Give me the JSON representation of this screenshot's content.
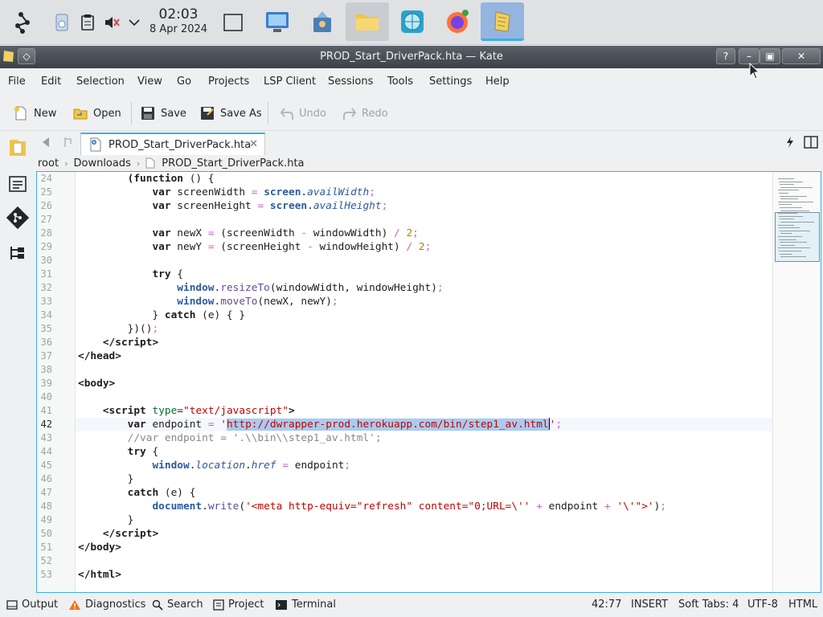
{
  "taskbar": {
    "time": "02:03",
    "date": "8 Apr 2024"
  },
  "window": {
    "title": "PROD_Start_DriverPack.hta — Kate",
    "help_button": "?"
  },
  "menu": {
    "file": "File",
    "edit": "Edit",
    "selection": "Selection",
    "view": "View",
    "go": "Go",
    "projects": "Projects",
    "lsp": "LSP Client",
    "sessions": "Sessions",
    "tools": "Tools",
    "settings": "Settings",
    "help": "Help"
  },
  "toolbar": {
    "new": "New",
    "open": "Open",
    "save": "Save",
    "save_as": "Save As",
    "undo": "Undo",
    "redo": "Redo"
  },
  "tab": {
    "label": "PROD_Start_DriverPack.hta",
    "close": "✕"
  },
  "breadcrumb": {
    "root": "root",
    "folder": "Downloads",
    "file": "PROD_Start_DriverPack.hta"
  },
  "editor": {
    "current_line": 42,
    "line_numbers": [
      "24",
      "25",
      "26",
      "27",
      "28",
      "29",
      "30",
      "31",
      "32",
      "33",
      "34",
      "35",
      "36",
      "37",
      "38",
      "39",
      "40",
      "41",
      "42",
      "43",
      "44",
      "45",
      "46",
      "47",
      "48",
      "49",
      "50",
      "51",
      "52",
      "53"
    ]
  },
  "statusbar": {
    "output": "Output",
    "diagnostics": "Diagnostics",
    "search": "Search",
    "project": "Project",
    "terminal": "Terminal",
    "position": "42:77",
    "mode": "INSERT",
    "indent": "Soft Tabs: 4",
    "encoding": "UTF-8",
    "language": "HTML"
  },
  "colors": {
    "accent": "#3daee9",
    "selection": "#a9cbf0",
    "string": "#bf0303",
    "number": "#b08000",
    "comment": "#898887",
    "attribute": "#006e28",
    "object": "#2c5aa0"
  }
}
